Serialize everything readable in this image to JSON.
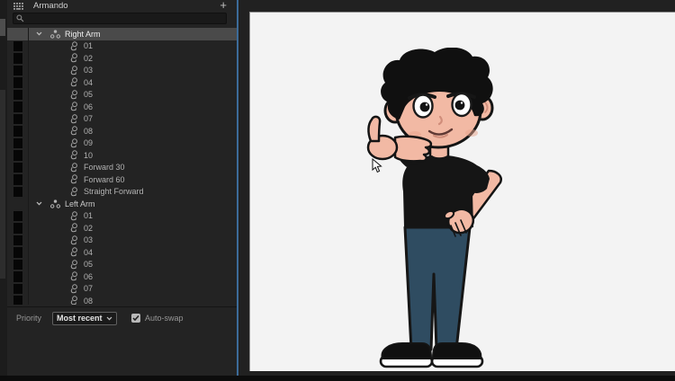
{
  "triggers_panel": {
    "title": "Armando",
    "add_button_label": "+",
    "search": {
      "placeholder": "",
      "value": ""
    },
    "groups": [
      {
        "label": "Right Arm",
        "selected": true,
        "items": [
          "01",
          "02",
          "03",
          "04",
          "05",
          "06",
          "07",
          "08",
          "09",
          "10",
          "Forward 30",
          "Forward 60",
          "Straight Forward"
        ]
      },
      {
        "label": "Left Arm",
        "selected": false,
        "items": [
          "01",
          "02",
          "03",
          "04",
          "05",
          "06",
          "07",
          "08"
        ]
      }
    ],
    "footer": {
      "priority_label": "Priority",
      "priority_value": "Most recent",
      "auto_swap_label": "Auto-swap",
      "auto_swap_checked": true
    }
  },
  "stage": {
    "character_pose": "thumbs-up",
    "cursor_visible": true
  },
  "colors": {
    "panel_divider_accent": "#3c6b99",
    "selected_row": "#4a4a4a",
    "panel_background": "#232323",
    "stage_background": "#f3f3f3",
    "skin": "#f2b9a4",
    "hair": "#101010",
    "shirt": "#151515",
    "jeans": "#2f4c61",
    "outline": "#141414"
  }
}
